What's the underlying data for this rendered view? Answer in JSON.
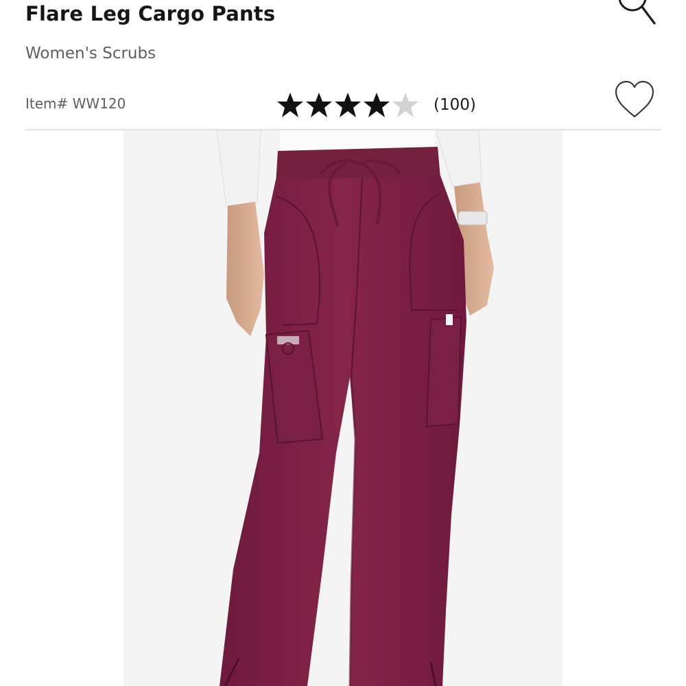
{
  "product": {
    "title": "Flare Leg Cargo Pants",
    "category": "Women's Scrubs",
    "item_number": "Item# WW120",
    "rating": 4,
    "rating_max": 5,
    "review_count": "(100)"
  },
  "icons": {
    "search": "search-icon",
    "favorite": "heart-outline-icon",
    "star": "star-icon"
  },
  "colors": {
    "star_filled": "#111111",
    "star_empty": "#d2d2d2",
    "pants": "#7b1f45",
    "divider": "#e2e2e2"
  }
}
